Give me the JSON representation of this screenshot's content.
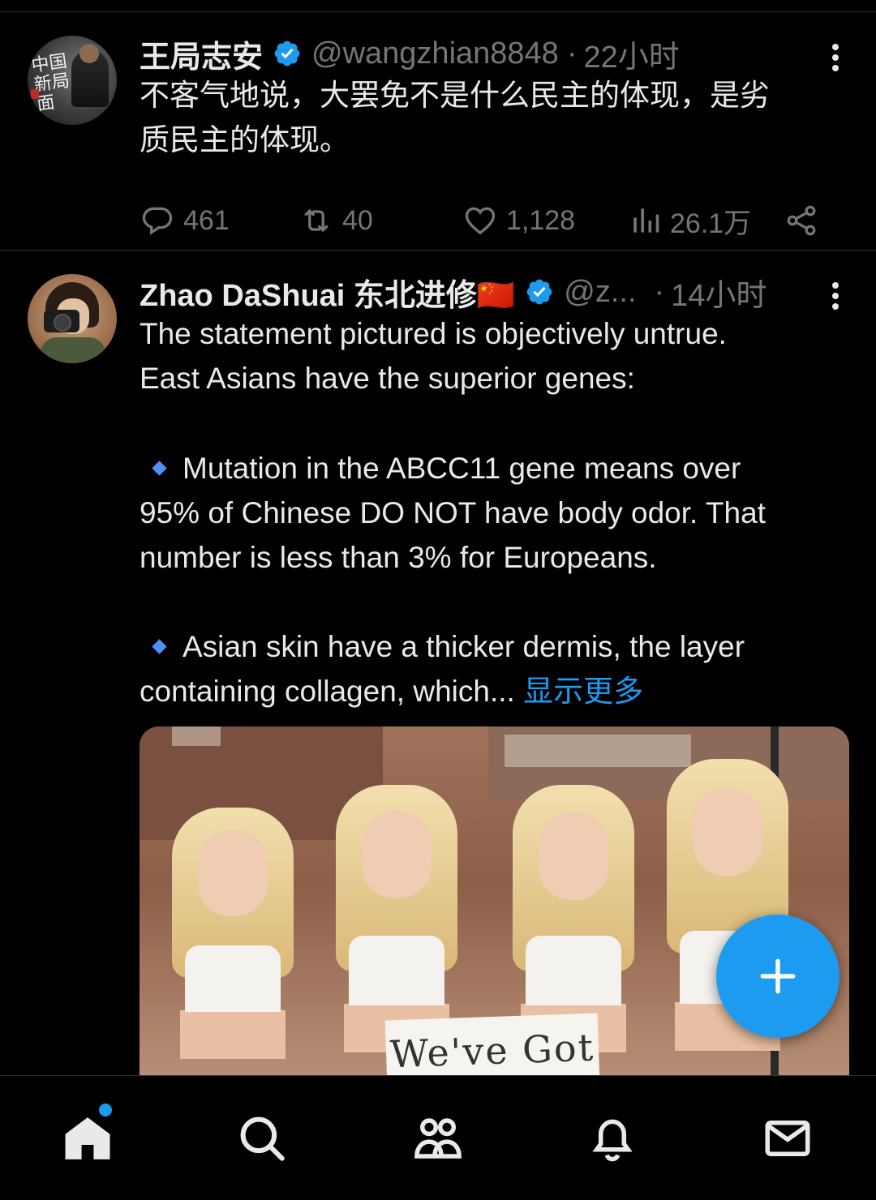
{
  "tweets": [
    {
      "name": "王局志安",
      "handle": "@wangzhian8848",
      "dot": "·",
      "time": "22小时",
      "text": "不客气地说，大罢免不是什么民主的体现，是劣\n质民主的体现。",
      "avatar_text": "中国新局面",
      "actions": {
        "replies": "461",
        "reposts": "40",
        "likes": "1,128",
        "views": "26.1万"
      }
    },
    {
      "name": "Zhao DaShuai 东北进修🇨🇳",
      "handle": "@z...",
      "dot": "·",
      "time": "14小时",
      "paragraph1": "The statement pictured is objectively untrue.\nEast Asians have the superior genes:",
      "bullet1": "Mutation in the ABCC11 gene means over\n95% of Chinese DO NOT have body odor. That\nnumber is less than 3% for Europeans.",
      "bullet2": "Asian skin have a thicker dermis, the layer\ncontaining collagen, which...",
      "show_more": "显示更多",
      "image_sign_text": "We've Got"
    }
  ],
  "icons": {
    "verified": "verified-badge-icon",
    "more": "more-dots-icon",
    "reply": "reply-icon",
    "repost": "repost-icon",
    "like": "heart-icon",
    "views": "views-icon",
    "share": "share-icon",
    "compose": "plus-icon"
  },
  "bottom_nav": [
    "home-icon",
    "search-icon",
    "communities-icon",
    "notifications-icon",
    "messages-icon"
  ],
  "colors": {
    "background": "#000000",
    "text": "#e7e9ea",
    "secondary": "#71767b",
    "accent": "#1d9bf0",
    "divider": "#2f3336"
  }
}
